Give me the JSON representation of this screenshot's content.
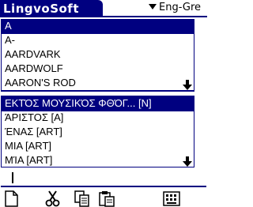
{
  "app": {
    "title": "LingvoSoft"
  },
  "dictionary": {
    "selected": "Eng-Gre"
  },
  "top_list": {
    "items": [
      "A",
      "A-",
      "AARDVARK",
      "AARDWOLF",
      "AARON'S ROD"
    ],
    "selected_index": 0
  },
  "bottom_list": {
    "items": [
      "ΕΚΤΌΣ ΜΟΥΣΙΚΌΣ ΦΘΌΓ... [N]",
      "ΆΡΙΣΤΟΣ [A]",
      "ΈΝΑΣ [ART]",
      "ΜΙΑ [ART]",
      "ΜΊΑ [ART]"
    ],
    "selected_index": 0
  },
  "input": {
    "value": ""
  },
  "toolbar": {
    "buttons": [
      "new-icon",
      "cut-icon",
      "copy-icon",
      "paste-icon",
      "keyboard-icon"
    ]
  },
  "colors": {
    "accent": "#000080",
    "background": "#ffffff"
  }
}
